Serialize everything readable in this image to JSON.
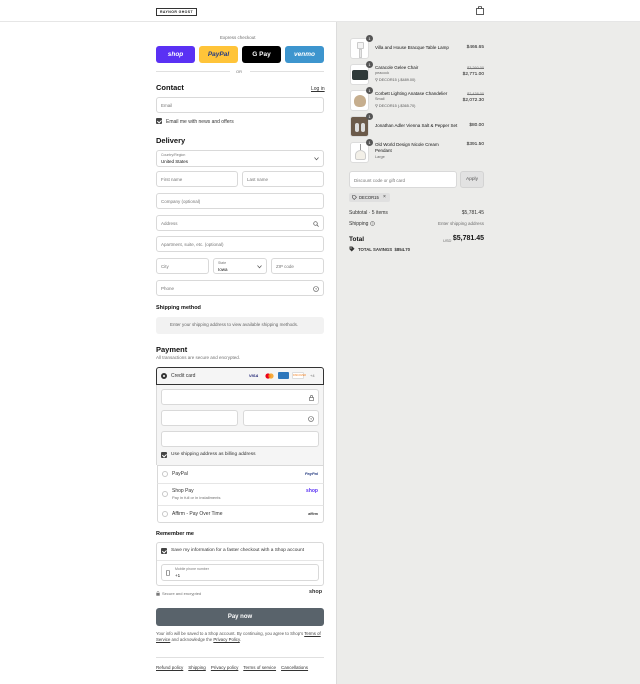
{
  "header": {
    "logo": "RAYNOR GHOST",
    "cart_icon": "shopping-bag-icon"
  },
  "express": {
    "title": "Express checkout",
    "buttons": [
      {
        "label": "shop",
        "color": "#5a31f4"
      },
      {
        "label": "PayPal",
        "color": "#ffc439"
      },
      {
        "label": "G Pay",
        "color": "#000000"
      },
      {
        "label": "venmo",
        "color": "#3d95ce"
      }
    ],
    "or": "OR"
  },
  "contact": {
    "title": "Contact",
    "login": "Log in",
    "email_placeholder": "Email",
    "news_label": "Email me with news and offers"
  },
  "delivery": {
    "title": "Delivery",
    "country_label": "Country/Region",
    "country_value": "United States",
    "first_name": "First name",
    "last_name": "Last name",
    "company": "Company (optional)",
    "address": "Address",
    "apartment": "Apartment, suite, etc. (optional)",
    "city": "City",
    "state_label": "State",
    "state_value": "Iowa",
    "zip": "ZIP code",
    "phone": "Phone"
  },
  "shipping": {
    "title": "Shipping method",
    "message": "Enter your shipping address to view available shipping methods."
  },
  "payment": {
    "title": "Payment",
    "subtitle": "All transactions are secure and encrypted.",
    "credit_card": "Credit card",
    "more_cards": "+4",
    "billing_label": "Use shipping address as billing address",
    "paypal": "PayPal",
    "paypal_logo": "PayPal",
    "shop_pay": "Shop Pay",
    "shop_pay_sub": "Pay in full or in installments",
    "shop_logo": "shop",
    "affirm": "Affirm - Pay Over Time",
    "affirm_logo": "affirm"
  },
  "remember": {
    "title": "Remember me",
    "save_label": "Save my information for a faster checkout with a Shop account",
    "mobile_label": "Mobile phone number",
    "mobile_value": "+1",
    "secure": "Secure and encrypted",
    "shop_logo": "shop"
  },
  "pay_button": "Pay now",
  "legal": {
    "line1": "Your info will be saved to a Shop account. By continuing, you agree to Shop's",
    "tos": "Terms of Service",
    "and": "and acknowledge the",
    "privacy": "Privacy Policy",
    "period": "."
  },
  "footer_links": [
    "Refund policy",
    "Shipping",
    "Privacy policy",
    "Terms of service",
    "Cancellations"
  ],
  "cart": {
    "items": [
      {
        "qty": "1",
        "name": "Villa and House Bracque Table Lamp",
        "variant": "",
        "discount": "",
        "original": "",
        "price": "$466.65"
      },
      {
        "qty": "1",
        "name": "Caracole Gelee Chair",
        "variant": "peacock",
        "discount": "DECOR15 (-$489.00)",
        "original": "$3,260.00",
        "price": "$2,771.00"
      },
      {
        "qty": "1",
        "name": "Corbett Lighting Anatase Chandelier",
        "variant": "Small",
        "discount": "DECOR15 (-$365.70)",
        "original": "$2,438.00",
        "price": "$2,072.30"
      },
      {
        "qty": "1",
        "name": "Jonathan Adler Vienna Salt & Pepper Set",
        "variant": "",
        "discount": "",
        "original": "",
        "price": "$80.00"
      },
      {
        "qty": "1",
        "name": "Old World Design Nicole Cream Pendant",
        "variant": "Large",
        "discount": "",
        "original": "",
        "price": "$391.50"
      }
    ],
    "discount_placeholder": "Discount code or gift card",
    "apply": "Apply",
    "code": "DECOR15",
    "subtotal_label": "Subtotal · 5 items",
    "subtotal": "$5,781.45",
    "shipping_label": "Shipping",
    "shipping_value": "Enter shipping address",
    "total_label": "Total",
    "currency": "USD",
    "total": "$5,781.45",
    "savings_label": "TOTAL SAVINGS",
    "savings": "$854.70"
  }
}
